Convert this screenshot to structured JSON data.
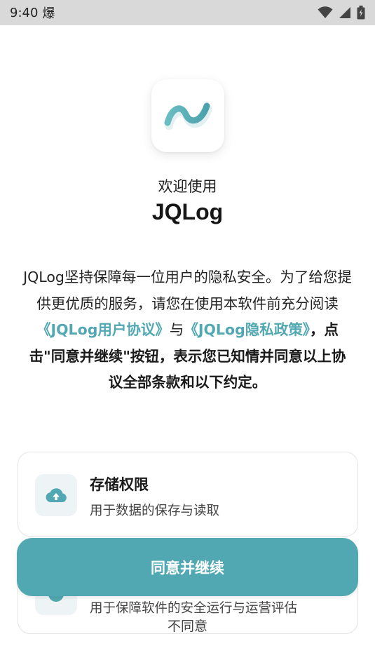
{
  "status_bar": {
    "time": "9:40",
    "notification_glyph": "爆"
  },
  "welcome": {
    "greeting": "欢迎使用",
    "app_name": "JQLog"
  },
  "intro": {
    "part1": "JQLog坚持保障每一位用户的隐私安全。为了给您提供更优质的服务，请您在使用本软件前充分阅读",
    "user_agreement_link": "《JQLog用户协议》",
    "and_text": "与",
    "privacy_policy_link": "《JQLog隐私政策》",
    "part2": "，点击\"同意并继续\"按钮，表示您已知情并同意以上协议全部条款和以下约定。"
  },
  "permissions": [
    {
      "title": "存储权限",
      "description": "用于数据的保存与读取",
      "icon": "cloud-upload-icon"
    },
    {
      "title": "",
      "description": "用于保障软件的安全运行与运营评估",
      "icon": "security-icon"
    }
  ],
  "actions": {
    "agree_label": "同意并继续",
    "disagree_label": "不同意"
  },
  "colors": {
    "accent": "#52a8b2",
    "icon_bg": "#eef4f5",
    "status_bar_bg": "#d9d9d9"
  }
}
